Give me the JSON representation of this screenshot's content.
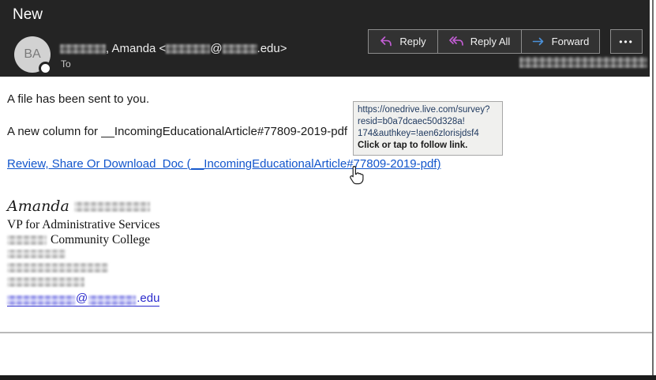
{
  "header": {
    "title": "New",
    "avatar_initials": "BA",
    "sender_name_visible": ", Amanda <",
    "sender_at": "@",
    "sender_domain_visible": ".edu>",
    "to_label": "To",
    "toolbar": {
      "reply": "Reply",
      "reply_all": "Reply All",
      "forward": "Forward",
      "more": "•••"
    }
  },
  "body": {
    "greeting": "A file has been sent to you.",
    "subject_line": "A new column for __IncomingEducationalArticle#77809-2019-pdf",
    "link_text": "Review, Share Or Download  Doc (__IncomingEducationalArticle#77809-2019-pdf)"
  },
  "tooltip": {
    "url_line1": "https://onedrive.live.com/survey?",
    "url_line2": "resid=b0a7dcaec50d328a!",
    "url_line3": "174&authkey=!aen6zlorisjdsf4",
    "hint": "Click or tap to follow link."
  },
  "signature": {
    "first_name": "Amanda",
    "role": "VP for Administrative Services",
    "org_visible": "Community College",
    "email_at": "@",
    "email_suffix": ".edu"
  },
  "colors": {
    "header_bg": "#242424",
    "link_blue": "#1155cc",
    "reply_icon": "#c45ed6",
    "forward_icon": "#4a90d9",
    "tooltip_bg": "#f0f0ee"
  }
}
